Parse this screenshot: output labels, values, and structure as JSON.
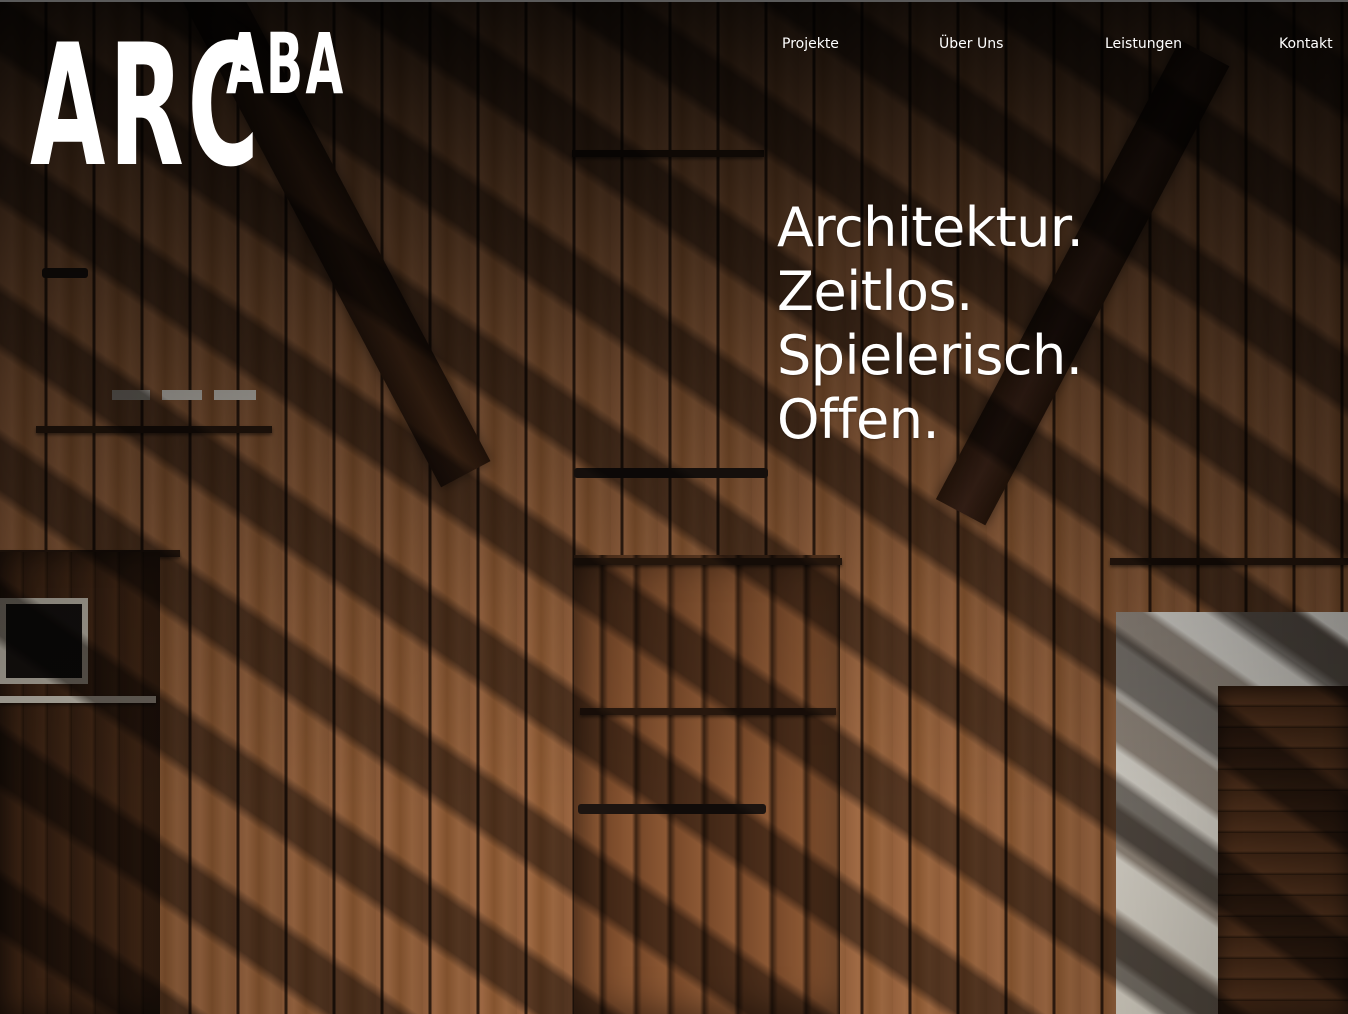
{
  "brand": {
    "logo_main": "ARC",
    "logo_sup": "ABA"
  },
  "nav": {
    "items": [
      {
        "label": "Projekte"
      },
      {
        "label": "Über Uns"
      },
      {
        "label": "Leistungen"
      },
      {
        "label": "Kontakt"
      }
    ]
  },
  "hero": {
    "tagline_lines": [
      "Architektur.",
      "Zeitlos.",
      "Spielerisch.",
      "Offen."
    ],
    "image": "wooden-barn-facade-photo"
  },
  "colors": {
    "text": "#ffffff",
    "wood": "#8a5a38",
    "overlay": "#000000"
  }
}
